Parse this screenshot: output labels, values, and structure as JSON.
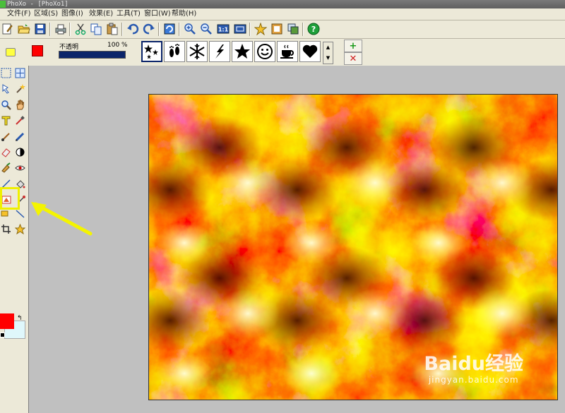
{
  "window": {
    "title": "PhoXo - [PhoXo1]"
  },
  "menu": [
    {
      "label": "文件",
      "key": "(F)"
    },
    {
      "label": "区域",
      "key": "(S)"
    },
    {
      "label": "图像",
      "key": "(I)"
    },
    {
      "label": "效果",
      "key": "(E)"
    },
    {
      "label": "工具",
      "key": "(T)"
    },
    {
      "label": "窗口",
      "key": "(W)"
    },
    {
      "label": "帮助",
      "key": "(H)"
    }
  ],
  "toolbar": {
    "icons": [
      "new-icon",
      "open-icon",
      "save-icon",
      "print-icon",
      "cut-icon",
      "copy-icon",
      "paste-icon",
      "undo-icon",
      "redo-icon",
      "refresh-icon",
      "zoom-in-icon",
      "zoom-out-icon",
      "actual-size-icon",
      "fit-window-icon",
      "favorite-icon",
      "frame-icon",
      "layer-icon",
      "help-icon"
    ],
    "actual_size_label": "1:1"
  },
  "properties": {
    "opacity_label": "不透明",
    "opacity_value": "100 %",
    "opacity_percent": 100,
    "fill_color": "#ff0000",
    "brushes": [
      "stars",
      "footprints",
      "snowflake",
      "lightning",
      "star",
      "smiley",
      "teacup",
      "heart"
    ],
    "selected_brush": "stars"
  },
  "colors": {
    "foreground": "#ff0000",
    "background": "#dff7fb",
    "accent_highlight": "#f0f000"
  },
  "watermark": {
    "logo": "Baidu经验",
    "url": "jingyan.baidu.com"
  }
}
